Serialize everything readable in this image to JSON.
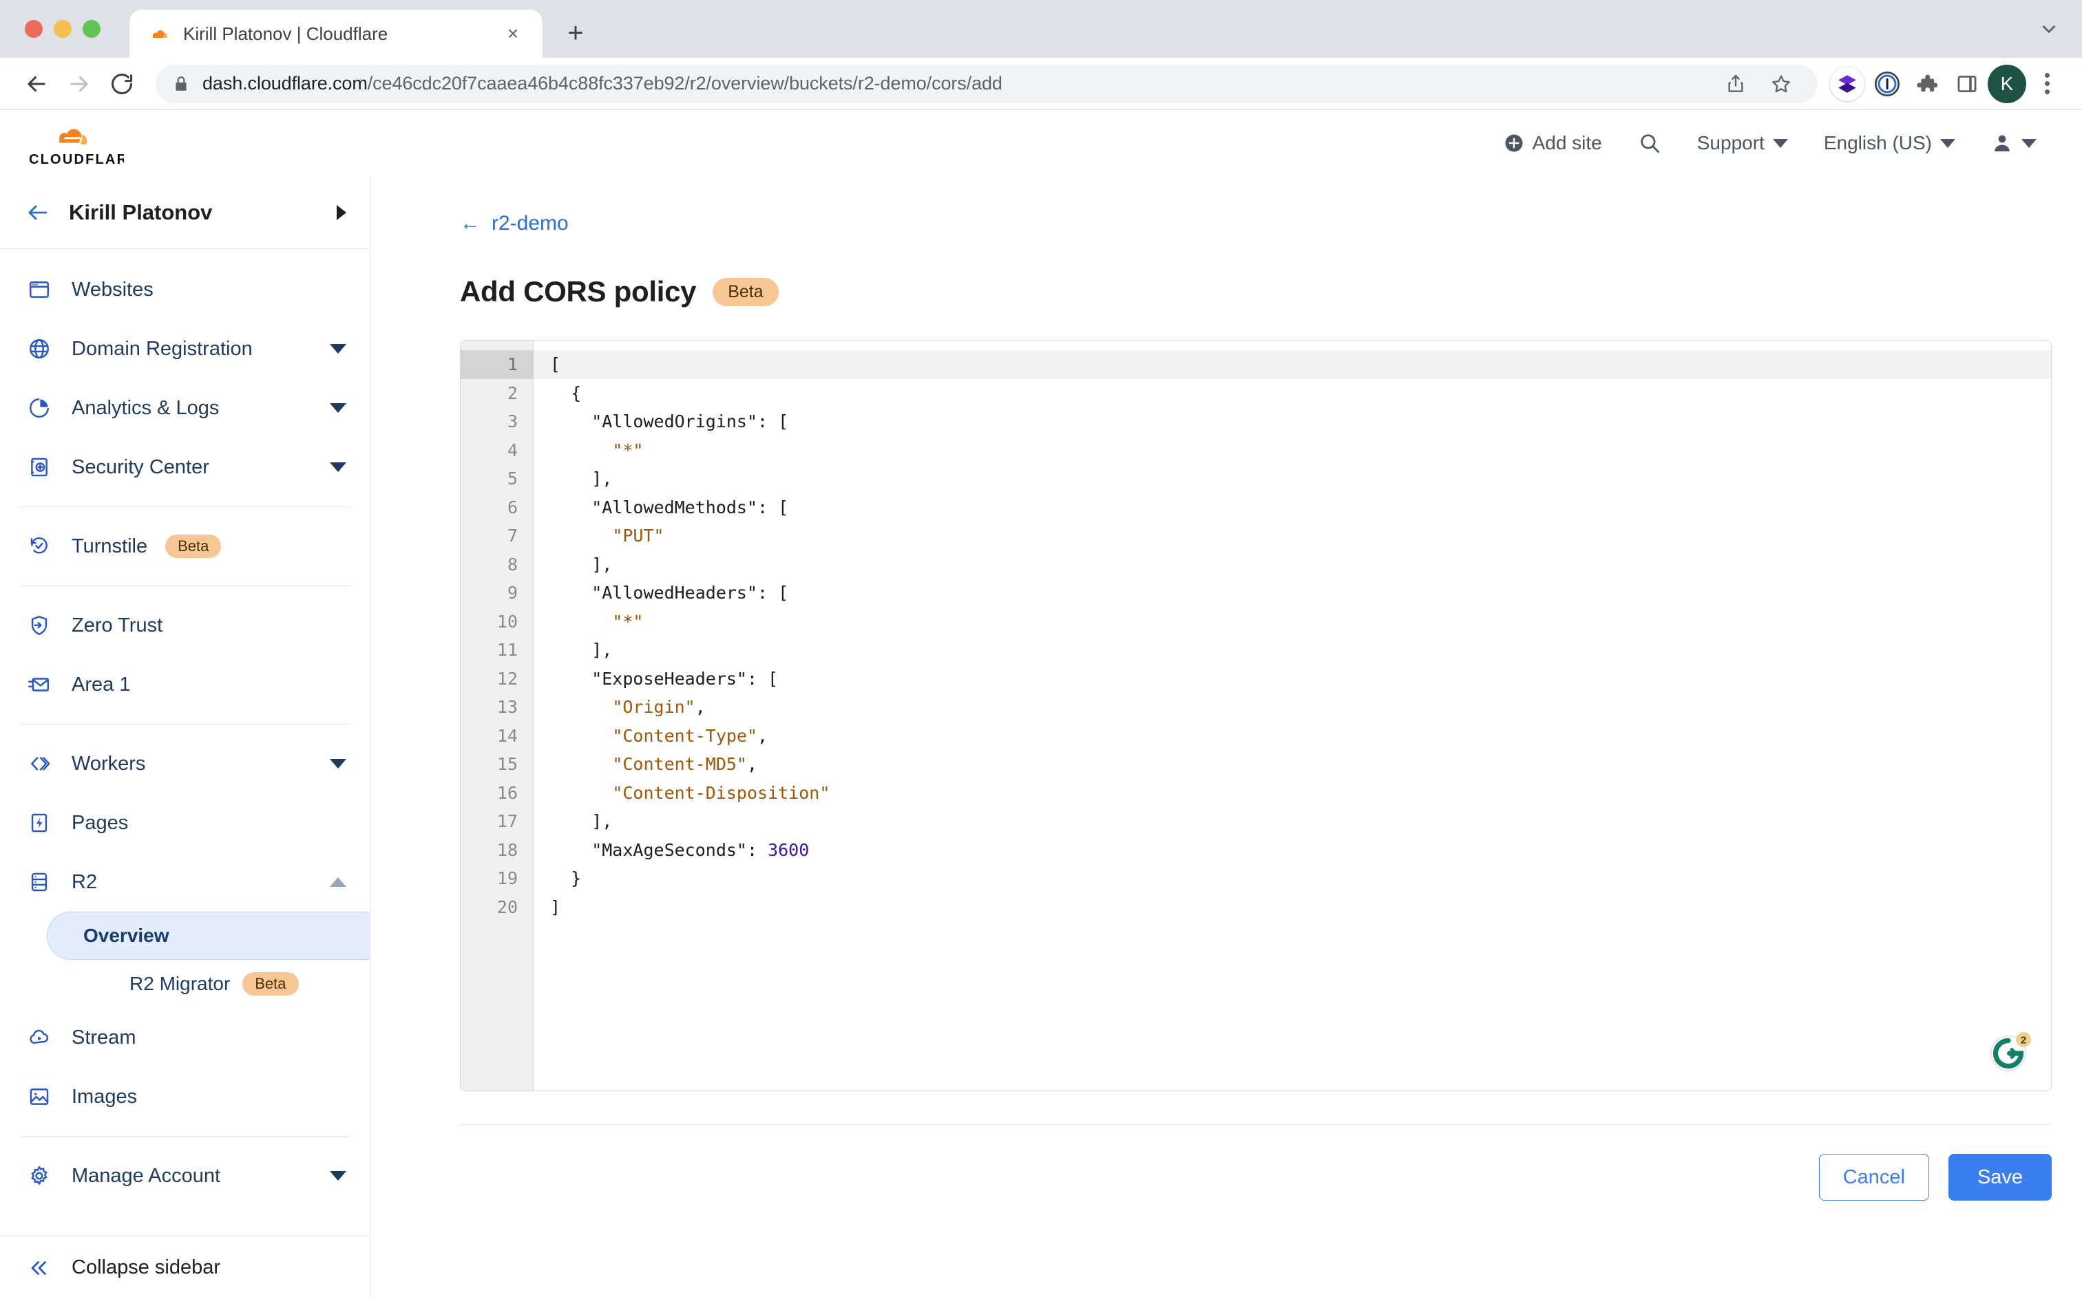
{
  "browser": {
    "tab": {
      "title": "Kirill Platonov | Cloudflare",
      "favicon": "cloudflare-favicon",
      "close_label": "×"
    },
    "new_tab_label": "+",
    "address": {
      "host": "dash.cloudflare.com",
      "path": "/ce46cdc20f7caaea46b4c88fc337eb92/r2/overview/buckets/r2-demo/cors/add",
      "full": "dash.cloudflare.com/ce46cdc20f7caaea46b4c88fc337eb92/r2/overview/buckets/r2-demo/cors/add",
      "secure_icon": "lock-icon"
    },
    "nav_icons": [
      "back-arrow-icon",
      "forward-arrow-icon",
      "reload-icon"
    ],
    "toolbar_icons": [
      "share-icon",
      "bookmark-star-icon",
      "layers-extension-icon",
      "onepassword-extension-icon",
      "puzzle-extensions-icon",
      "sidebar-panel-icon"
    ],
    "profile_initial": "K",
    "menu_icon": "three-dot-menu-icon"
  },
  "cf_header": {
    "logo_text": "CLOUDFLARE",
    "add_site": "Add site",
    "search_icon": "search-icon",
    "support": "Support",
    "language": "English (US)",
    "account_icon": "user-avatar-icon"
  },
  "sidebar": {
    "account_name": "Kirill Platonov",
    "back_icon": "back-arrow-icon",
    "items": [
      {
        "label": "Websites",
        "icon": "browser-window-icon",
        "caret": false
      },
      {
        "label": "Domain Registration",
        "icon": "globe-icon",
        "caret": true
      },
      {
        "label": "Analytics & Logs",
        "icon": "pie-chart-icon",
        "caret": true
      },
      {
        "label": "Security Center",
        "icon": "safe-vault-icon",
        "caret": true
      },
      {
        "label": "Turnstile",
        "icon": "turnstile-refresh-check-icon",
        "caret": false,
        "badge": "Beta"
      },
      {
        "label": "Zero Trust",
        "icon": "shield-arrow-icon",
        "caret": false
      },
      {
        "label": "Area 1",
        "icon": "envelope-icon",
        "caret": false
      },
      {
        "label": "Workers",
        "icon": "code-brackets-icon",
        "caret": true
      },
      {
        "label": "Pages",
        "icon": "page-lightning-icon",
        "caret": false
      },
      {
        "label": "R2",
        "icon": "database-icon",
        "caret": true,
        "expanded": true
      },
      {
        "label": "Stream",
        "icon": "cloud-play-icon",
        "caret": false
      },
      {
        "label": "Images",
        "icon": "image-icon",
        "caret": false
      },
      {
        "label": "Manage Account",
        "icon": "gear-icon",
        "caret": true
      }
    ],
    "r2_children": [
      {
        "label": "Overview",
        "active": true
      },
      {
        "label": "R2 Migrator",
        "active": false,
        "badge": "Beta"
      }
    ],
    "collapse": {
      "label": "Collapse sidebar",
      "icon": "double-chevron-left-icon"
    }
  },
  "main": {
    "breadcrumb": {
      "arrow": "←",
      "label": "r2-demo"
    },
    "title": "Add CORS policy",
    "title_badge": "Beta",
    "editor": {
      "active_line": 1,
      "lines": [
        {
          "n": 1,
          "indent": 0,
          "tokens": [
            {
              "t": "[",
              "c": "plain"
            }
          ]
        },
        {
          "n": 2,
          "indent": 1,
          "tokens": [
            {
              "t": "{",
              "c": "plain"
            }
          ]
        },
        {
          "n": 3,
          "indent": 2,
          "tokens": [
            {
              "t": "\"AllowedOrigins\": [",
              "c": "plain"
            }
          ]
        },
        {
          "n": 4,
          "indent": 3,
          "tokens": [
            {
              "t": "\"*\"",
              "c": "str"
            }
          ]
        },
        {
          "n": 5,
          "indent": 2,
          "tokens": [
            {
              "t": "],",
              "c": "plain"
            }
          ]
        },
        {
          "n": 6,
          "indent": 2,
          "tokens": [
            {
              "t": "\"AllowedMethods\": [",
              "c": "plain"
            }
          ]
        },
        {
          "n": 7,
          "indent": 3,
          "tokens": [
            {
              "t": "\"PUT\"",
              "c": "str"
            }
          ]
        },
        {
          "n": 8,
          "indent": 2,
          "tokens": [
            {
              "t": "],",
              "c": "plain"
            }
          ]
        },
        {
          "n": 9,
          "indent": 2,
          "tokens": [
            {
              "t": "\"AllowedHeaders\": [",
              "c": "plain"
            }
          ]
        },
        {
          "n": 10,
          "indent": 3,
          "tokens": [
            {
              "t": "\"*\"",
              "c": "str"
            }
          ]
        },
        {
          "n": 11,
          "indent": 2,
          "tokens": [
            {
              "t": "],",
              "c": "plain"
            }
          ]
        },
        {
          "n": 12,
          "indent": 2,
          "tokens": [
            {
              "t": "\"ExposeHeaders\": [",
              "c": "plain"
            }
          ]
        },
        {
          "n": 13,
          "indent": 3,
          "tokens": [
            {
              "t": "\"Origin\"",
              "c": "str"
            },
            {
              "t": ",",
              "c": "plain"
            }
          ]
        },
        {
          "n": 14,
          "indent": 3,
          "tokens": [
            {
              "t": "\"Content-Type\"",
              "c": "str"
            },
            {
              "t": ",",
              "c": "plain"
            }
          ]
        },
        {
          "n": 15,
          "indent": 3,
          "tokens": [
            {
              "t": "\"Content-MD5\"",
              "c": "str"
            },
            {
              "t": ",",
              "c": "plain"
            }
          ]
        },
        {
          "n": 16,
          "indent": 3,
          "tokens": [
            {
              "t": "\"Content-Disposition\"",
              "c": "str"
            }
          ]
        },
        {
          "n": 17,
          "indent": 2,
          "tokens": [
            {
              "t": "],",
              "c": "plain"
            }
          ]
        },
        {
          "n": 18,
          "indent": 2,
          "tokens": [
            {
              "t": "\"MaxAgeSeconds\": ",
              "c": "plain"
            },
            {
              "t": "3600",
              "c": "num"
            }
          ]
        },
        {
          "n": 19,
          "indent": 1,
          "tokens": [
            {
              "t": "}",
              "c": "plain"
            }
          ]
        },
        {
          "n": 20,
          "indent": 0,
          "tokens": [
            {
              "t": "]",
              "c": "plain"
            }
          ]
        }
      ],
      "grammarly": {
        "icon": "grammarly-icon",
        "count": "2"
      }
    },
    "cancel_label": "Cancel",
    "save_label": "Save"
  },
  "colors": {
    "accent_blue": "#3b7ef0",
    "link_blue": "#2c6ecb",
    "sidebar_navy": "#1e3a5f",
    "beta_badge_bg": "#f6c794",
    "cloudflare_orange": "#f6821f",
    "string_token": "#a1560a",
    "number_token": "#3b16a8"
  }
}
